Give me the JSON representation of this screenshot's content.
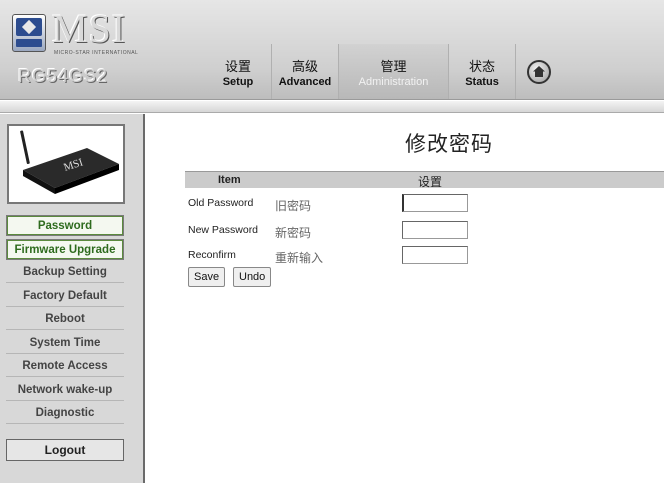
{
  "header": {
    "logo_text": "MSI",
    "logo_tagline": "MICRO-STAR INTERNATIONAL",
    "model": "RG54GS2"
  },
  "nav": {
    "tabs": [
      {
        "zh": "设置",
        "en": "Setup"
      },
      {
        "zh": "高级",
        "en": "Advanced"
      },
      {
        "zh": "管理",
        "en": "Administration",
        "active": true
      },
      {
        "zh": "状态",
        "en": "Status"
      }
    ],
    "home_icon": "home-icon"
  },
  "sidebar": {
    "items": [
      {
        "label": "Password",
        "active": true
      },
      {
        "label": "Firmware Upgrade"
      },
      {
        "label": "Backup Setting"
      },
      {
        "label": "Factory Default"
      },
      {
        "label": "Reboot"
      },
      {
        "label": "System Time"
      },
      {
        "label": "Remote Access"
      },
      {
        "label": "Network wake-up"
      },
      {
        "label": "Diagnostic"
      }
    ],
    "logout_label": "Logout"
  },
  "main": {
    "title": "修改密码",
    "table": {
      "col_item": "Item",
      "col_settings": "设置"
    },
    "fields": [
      {
        "en": "Old Password",
        "zh": "旧密码",
        "value": ""
      },
      {
        "en": "New Password",
        "zh": "新密码",
        "value": ""
      },
      {
        "en": "Reconfirm",
        "zh": "重新输入",
        "value": ""
      }
    ],
    "save_label": "Save",
    "undo_label": "Undo"
  },
  "colors": {
    "active_green": "#2e6b1e",
    "header_gray": "#cfcfcf"
  }
}
